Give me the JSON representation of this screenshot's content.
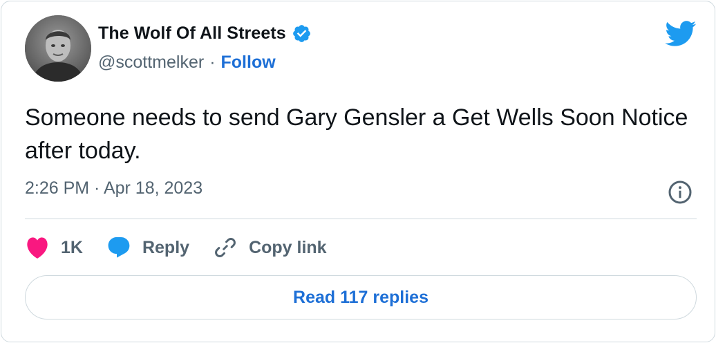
{
  "author": {
    "name": "The Wolf Of All Streets",
    "handle": "@scottmelker",
    "separator": "·",
    "follow_label": "Follow",
    "avatar_icon": "avatar-photo",
    "verified_icon": "verified-badge-icon"
  },
  "tweet": {
    "text": "Someone needs to send Gary Gensler a Get Wells Soon Notice after today.",
    "timestamp": "2:26 PM · Apr 18, 2023"
  },
  "actions": {
    "like_count": "1K",
    "reply_label": "Reply",
    "copy_link_label": "Copy link"
  },
  "read_replies_label": "Read 117 replies",
  "colors": {
    "brand_blue": "#1d9bf0",
    "link_blue": "#1d6fd6",
    "like_pink": "#f91880",
    "muted_text": "#536471",
    "border": "#cfd9de"
  }
}
